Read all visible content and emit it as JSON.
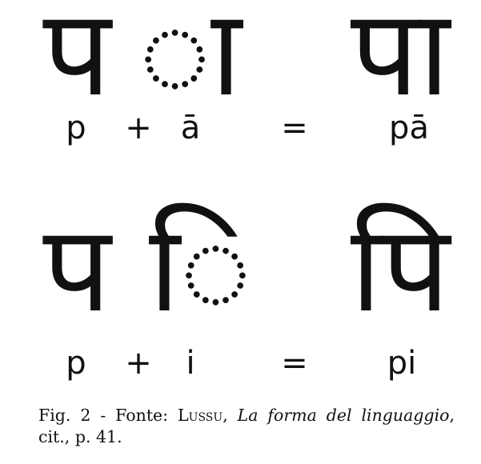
{
  "row1": {
    "glyph_p": "प",
    "glyph_a": "ा",
    "glyph_result": "पा",
    "label_p": "p",
    "plus": "+",
    "label_a": "ā",
    "equals": "=",
    "label_result": "pā"
  },
  "row2": {
    "glyph_p": "प",
    "glyph_i": "ि",
    "glyph_result": "पि",
    "label_p": "p",
    "plus": "+",
    "label_i": "i",
    "equals": "=",
    "label_result": "pi"
  },
  "caption": {
    "prefix": "Fig. 2 - Fonte: ",
    "author": "Lussu",
    "separator": ", ",
    "title": "La forma del linguaggio",
    "suffix": ", cit., p. 41."
  }
}
